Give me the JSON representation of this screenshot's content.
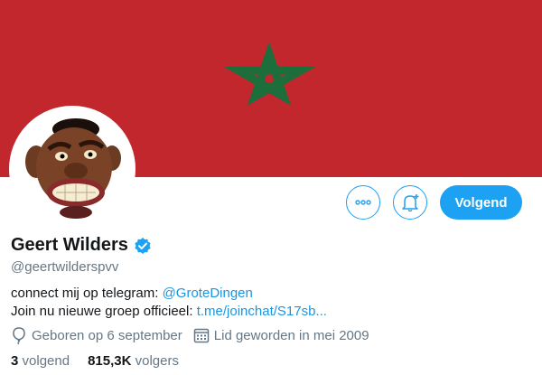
{
  "colors": {
    "banner_red": "#c1272d",
    "banner_star": "#1e6e3c",
    "accent": "#1da1f2",
    "link": "#1b95e0",
    "secondary_text": "#657786"
  },
  "profile": {
    "display_name": "Geert Wilders",
    "verified_icon": "verified-badge-icon",
    "handle": "@geertwilderspvv"
  },
  "actions": {
    "more_icon": "more-dots-icon",
    "notify_icon": "bell-plus-icon",
    "follow_label": "Volgend"
  },
  "bio": {
    "line1_prefix": "connect mij op telegram: ",
    "line1_link": "@GroteDingen",
    "line2_prefix": "Join nu nieuwe groep officieel: ",
    "line2_link": "t.me/joinchat/S17sb..."
  },
  "meta": {
    "birthday_icon": "balloon-icon",
    "birthday": "Geboren op 6 september",
    "joined_icon": "calendar-icon",
    "joined": "Lid geworden in mei 2009"
  },
  "stats": {
    "following_count": "3",
    "following_label": "volgend",
    "followers_count": "815,3K",
    "followers_label": "volgers"
  }
}
